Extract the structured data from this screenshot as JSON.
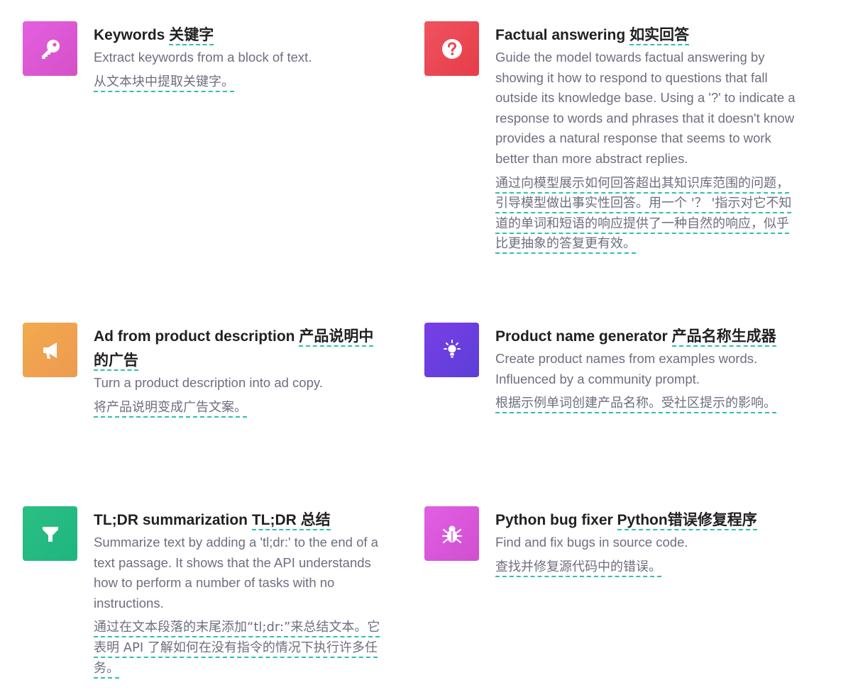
{
  "examples": [
    {
      "title_en": "Keywords",
      "title_zh": "关键字",
      "desc": "Extract keywords from a block of text.",
      "trans": "从文本块中提取关键字。",
      "icon": "key-icon",
      "color": "#e055d8"
    },
    {
      "title_en": "Factual answering",
      "title_zh": "如实回答",
      "desc": "Guide the model towards factual answering by showing it how to respond to questions that fall outside its knowledge base. Using a '?' to indicate a response to words and phrases that it doesn't know provides a natural response that seems to work better than more abstract replies.",
      "trans": "通过向模型展示如何回答超出其知识库范围的问题，引导模型做出事实性回答。用一个 '？ '指示对它不知道的单词和短语的响应提供了一种自然的响应，似乎比更抽象的答复更有效。",
      "icon": "question-icon",
      "color": "#ec4752"
    },
    {
      "title_en": "Ad from product description",
      "title_zh": "产品说明中的广告",
      "desc": "Turn a product description into ad copy.",
      "trans": "将产品说明变成广告文案。",
      "icon": "megaphone-icon",
      "color": "#f0a24e"
    },
    {
      "title_en": "Product name generator",
      "title_zh": "产品名称生成器",
      "desc": "Create product names from examples words. Influenced by a community prompt.",
      "trans": "根据示例单词创建产品名称。受社区提示的影响。",
      "icon": "lightbulb-icon",
      "color": "#6a3fdf"
    },
    {
      "title_en": "TL;DR summarization",
      "title_zh": "TL;DR 总结",
      "desc": "Summarize text by adding a 'tl;dr:' to the end of a text passage. It shows that the API understands how to perform a number of tasks with no instructions.",
      "trans": "通过在文本段落的末尾添加“tl;dr:”来总结文本。它表明 API 了解如何在没有指令的情况下执行许多任务。",
      "icon": "filter-icon",
      "color": "#25ba82"
    },
    {
      "title_en": "Python bug fixer",
      "title_zh": "Python错误修复程序",
      "desc": "Find and fix bugs in source code.",
      "trans": "查找并修复源代码中的错误。",
      "icon": "bug-icon",
      "color": "#dc57dc"
    }
  ]
}
